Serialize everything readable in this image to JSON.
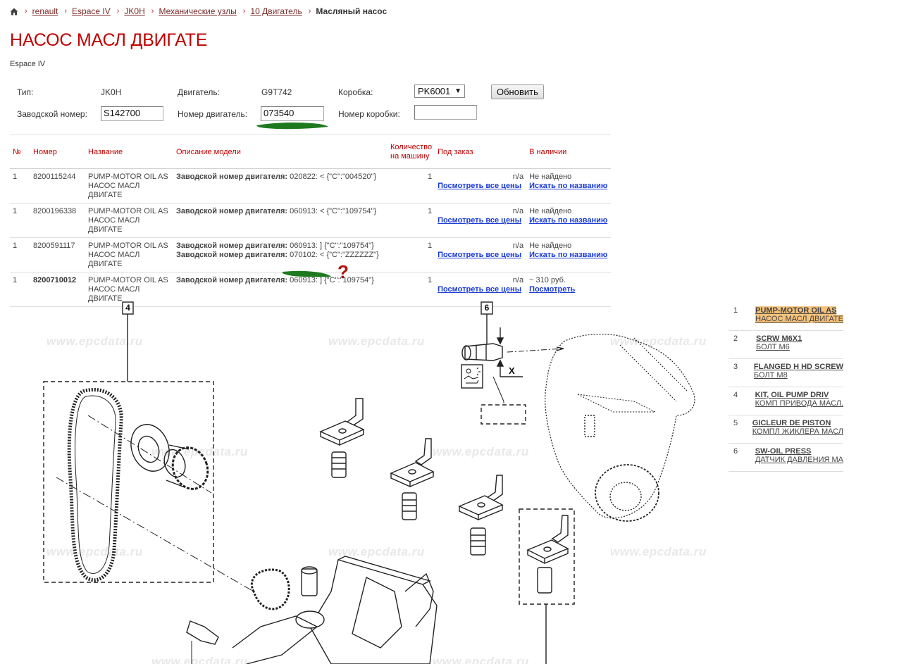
{
  "breadcrumb": {
    "items": [
      "renault",
      "Espace IV",
      "JK0H",
      "Механические узлы",
      "10 Двигатель"
    ],
    "current": "Масляный насос",
    "separator": "›"
  },
  "page": {
    "title": "НАСОС МАСЛ ДВИГАТЕ",
    "subtitle": "Espace IV"
  },
  "form": {
    "type_label": "Тип:",
    "type_value": "JK0H",
    "engine_label": "Двигатель:",
    "engine_value": "G9T742",
    "gearbox_label": "Коробка:",
    "gearbox_value": "PK6001",
    "update_button": "Обновить",
    "serial_label": "Заводской номер:",
    "serial_value": "S142700",
    "engine_num_label": "Номер двигатель:",
    "engine_num_value": "073540",
    "gearbox_num_label": "Номер коробки:",
    "gearbox_num_value": ""
  },
  "table": {
    "headers": [
      "№",
      "Номер",
      "Название",
      "Описание модели",
      "Количество на машину",
      "Под заказ",
      "В наличии"
    ],
    "rows": [
      {
        "n": "1",
        "number": "8200115244",
        "name1": "PUMP-MOTOR OIL AS",
        "name2": "НАСОС МАСЛ ДВИГАТЕ",
        "desc": [
          {
            "label": "Заводской номер двигателя:",
            "text": "020822: < {\"C\":\"004520\"}"
          }
        ],
        "qty": "1",
        "order": "n/a",
        "order_link": "Посмотреть все цены",
        "stock": "Не найдено",
        "stock_link": "Искать по названию",
        "bold": false
      },
      {
        "n": "1",
        "number": "8200196338",
        "name1": "PUMP-MOTOR OIL AS",
        "name2": "НАСОС МАСЛ ДВИГАТЕ",
        "desc": [
          {
            "label": "Заводской номер двигателя:",
            "text": "060913: < {\"C\":\"109754\"}"
          }
        ],
        "qty": "1",
        "order": "n/a",
        "order_link": "Посмотреть все цены",
        "stock": "Не найдено",
        "stock_link": "Искать по названию",
        "bold": false
      },
      {
        "n": "1",
        "number": "8200591117",
        "name1": "PUMP-MOTOR OIL AS",
        "name2": "НАСОС МАСЛ ДВИГАТЕ",
        "desc": [
          {
            "label": "Заводской номер двигателя:",
            "text": "060913: ] {\"C\":\"109754\"}"
          },
          {
            "label": "Заводской номер двигателя:",
            "text": "070102: < {\"C\":\"ZZZZZZ\"}"
          }
        ],
        "qty": "1",
        "order": "n/a",
        "order_link": "Посмотреть все цены",
        "stock": "Не найдено",
        "stock_link": "Искать по названию",
        "bold": false
      },
      {
        "n": "1",
        "number": "8200710012",
        "name1": "PUMP-MOTOR OIL AS",
        "name2": "НАСОС МАСЛ ДВИГАТЕ",
        "desc": [
          {
            "label": "Заводской номер двигателя:",
            "text": "060913: ] {\"C\":\"109754\"}"
          }
        ],
        "qty": "1",
        "order": "n/a",
        "order_link": "Посмотреть все цены",
        "stock": "~ 310 руб.",
        "stock_link": "Посмотреть",
        "bold": true
      }
    ]
  },
  "annotation": {
    "question_mark": "?",
    "marker_color": "#1f7a1f",
    "question_color": "#b01010"
  },
  "diagram": {
    "watermark": "www.epcdata.ru",
    "callouts": [
      "4",
      "6"
    ],
    "x_label": "X"
  },
  "sidebar": {
    "items": [
      {
        "n": "1",
        "en": "PUMP-MOTOR OIL AS",
        "ru": "НАСОС МАСЛ ДВИГАТЕ",
        "active": true
      },
      {
        "n": "2",
        "en": "SCRW M6X1",
        "ru": "БОЛТ М6",
        "active": false
      },
      {
        "n": "3",
        "en": "FLANGED H HD SCREW",
        "ru": "БОЛТ М8",
        "active": false
      },
      {
        "n": "4",
        "en": "KIT, OIL PUMP DRIV",
        "ru": "КОМП ПРИВОДА МАСЛ.",
        "active": false
      },
      {
        "n": "5",
        "en": "GICLEUR DE PISTON",
        "ru": "КОМПЛ ЖИКЛЕРА МАСЛ",
        "active": false
      },
      {
        "n": "6",
        "en": "SW-OIL PRESS",
        "ru": "ДАТЧИК ДАВЛЕНИЯ МА",
        "active": false
      }
    ]
  },
  "colors": {
    "title_red": "#c00000",
    "link_blue": "#1a3bd6",
    "highlight": "#f5c27a"
  }
}
